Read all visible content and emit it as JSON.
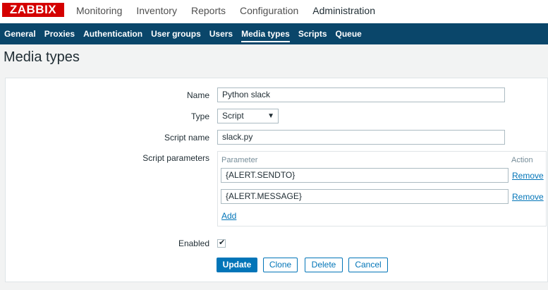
{
  "logo": "ZABBIX",
  "main_menu": [
    "Monitoring",
    "Inventory",
    "Reports",
    "Configuration",
    "Administration"
  ],
  "main_menu_active": "Administration",
  "sub_menu": [
    "General",
    "Proxies",
    "Authentication",
    "User groups",
    "Users",
    "Media types",
    "Scripts",
    "Queue"
  ],
  "sub_menu_active": "Media types",
  "page_title": "Media types",
  "form": {
    "name_label": "Name",
    "name_value": "Python slack",
    "type_label": "Type",
    "type_value": "Script",
    "script_name_label": "Script name",
    "script_name_value": "slack.py",
    "script_params_label": "Script parameters",
    "params_header_parameter": "Parameter",
    "params_header_action": "Action",
    "params": [
      {
        "value": "{ALERT.SENDTO}",
        "action": "Remove"
      },
      {
        "value": "{ALERT.MESSAGE}",
        "action": "Remove"
      }
    ],
    "add_label": "Add",
    "enabled_label": "Enabled",
    "enabled_checked": true
  },
  "buttons": {
    "update": "Update",
    "clone": "Clone",
    "delete": "Delete",
    "cancel": "Cancel"
  },
  "colors": {
    "brand": "#d40000",
    "nav": "#0a466a",
    "accent": "#0275b8"
  }
}
